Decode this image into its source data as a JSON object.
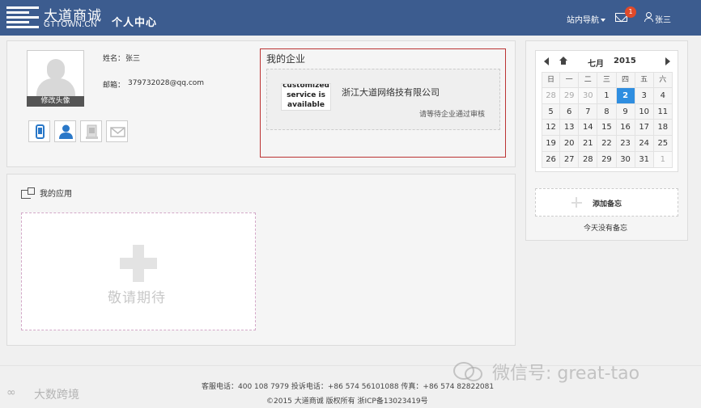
{
  "header": {
    "logo_cn": "大道商诚",
    "logo_en": "GTTOWN.CN",
    "page_title": "个人中心",
    "nav_label": "站内导航",
    "mail_badge": "1",
    "user_name": "张三"
  },
  "profile": {
    "avatar_button": "修改头像",
    "name_label": "姓名：",
    "name_value": "张三",
    "email_label": "邮箱：",
    "email_value": "379732028@qq.com",
    "icons": [
      "phone-icon",
      "user-icon",
      "id-card-icon",
      "mail-icon"
    ]
  },
  "enterprise": {
    "title": "我的企业",
    "logo_text": [
      "customized",
      "service is",
      "available"
    ],
    "name": "浙江大道网络技有限公司",
    "status": "请等待企业通过审核"
  },
  "apps": {
    "title": "我的应用",
    "placeholder": "敬请期待"
  },
  "calendar": {
    "month": "七月",
    "year": "2015",
    "weekdays": [
      "日",
      "一",
      "二",
      "三",
      "四",
      "五",
      "六"
    ],
    "weeks": [
      [
        {
          "d": "28",
          "m": true
        },
        {
          "d": "29",
          "m": true
        },
        {
          "d": "30",
          "m": true
        },
        {
          "d": "1"
        },
        {
          "d": "2",
          "today": true
        },
        {
          "d": "3"
        },
        {
          "d": "4"
        }
      ],
      [
        {
          "d": "5"
        },
        {
          "d": "6"
        },
        {
          "d": "7"
        },
        {
          "d": "8"
        },
        {
          "d": "9"
        },
        {
          "d": "10"
        },
        {
          "d": "11"
        }
      ],
      [
        {
          "d": "12"
        },
        {
          "d": "13"
        },
        {
          "d": "14"
        },
        {
          "d": "15"
        },
        {
          "d": "16"
        },
        {
          "d": "17"
        },
        {
          "d": "18"
        }
      ],
      [
        {
          "d": "19"
        },
        {
          "d": "20"
        },
        {
          "d": "21"
        },
        {
          "d": "22"
        },
        {
          "d": "23"
        },
        {
          "d": "24"
        },
        {
          "d": "25"
        }
      ],
      [
        {
          "d": "26"
        },
        {
          "d": "27"
        },
        {
          "d": "28"
        },
        {
          "d": "29"
        },
        {
          "d": "30"
        },
        {
          "d": "31"
        },
        {
          "d": "1",
          "m": true
        }
      ]
    ],
    "today_color": "#2f8ee0"
  },
  "memo": {
    "add_label": "添加备忘",
    "empty_text": "今天没有备忘"
  },
  "footer": {
    "contact": "客服电话：400 108 7979 投诉电话：+86 574 56101088 传真：+86 574 82822081",
    "copyright": "©2015 大道商诚 版权所有 浙ICP备13023419号"
  },
  "watermarks": {
    "right": "微信号: great-tao",
    "left_mark": "∞",
    "left": "大数跨境"
  },
  "colors": {
    "header_bg": "#3c5c8f",
    "enterprise_border": "#b33333",
    "badge": "#e04a2a"
  }
}
